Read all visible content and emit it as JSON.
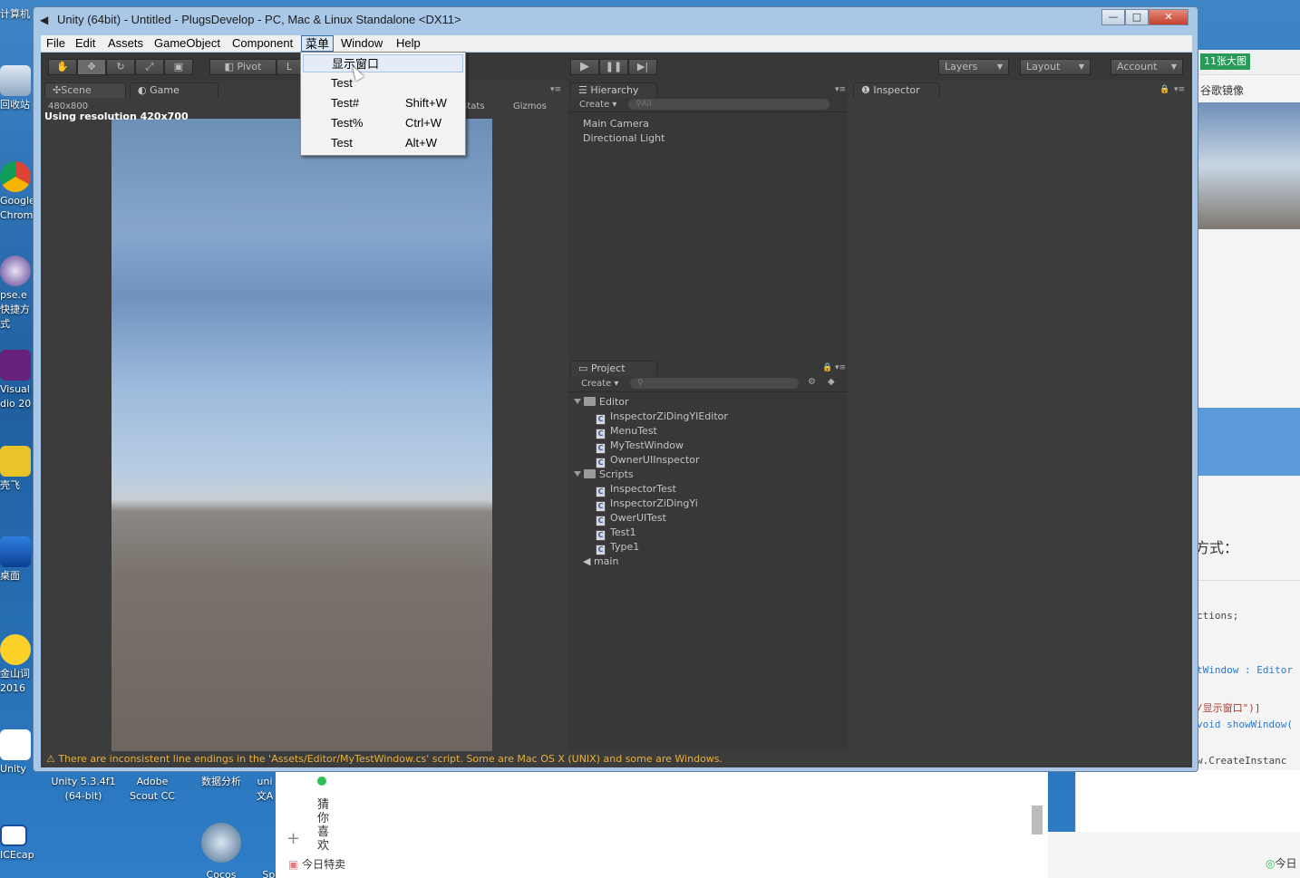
{
  "desktop": {
    "left_icons": [
      {
        "label": "计算机",
        "icon": "computer-icon"
      },
      {
        "label": "回收站",
        "icon": "recycle-bin-icon"
      },
      {
        "label": "Google Chrome",
        "line1": "Google",
        "line2": "Chrome",
        "icon": "chrome-icon"
      },
      {
        "label": "Eclipse",
        "line1": "pse.e",
        "line2": "快捷方式",
        "icon": "eclipse-icon"
      },
      {
        "label": "Visual Studio 2015",
        "line1": "Visual",
        "line2": "dio 20",
        "icon": "visual-studio-icon"
      },
      {
        "label": "飞壳",
        "line1": "壳飞",
        "icon": "app-m-icon"
      },
      {
        "label": "桌面",
        "line1": "桌面",
        "icon": "desktop-shortcut-icon"
      },
      {
        "label": "金山词霸 2016",
        "line1": "金山词",
        "line2": "2016",
        "icon": "dictionary-icon"
      },
      {
        "label": "Unity",
        "icon": "unity-icon"
      },
      {
        "label": "ICEcap",
        "icon": "icecap-icon"
      }
    ],
    "bottom_icons": [
      {
        "line1": "Unity 5.3.4f1",
        "line2": "(64-bit)"
      },
      {
        "line1": "Adobe",
        "line2": "Scout CC"
      },
      {
        "line1": "数据分析",
        "line2": ""
      },
      {
        "line1": "uni",
        "line2": "文A"
      },
      {
        "line1": "Cocos",
        "line2": ""
      },
      {
        "line1": "Splashplus",
        "line2": ""
      }
    ]
  },
  "bg_window": {
    "badge": "11张大图",
    "link": "谷歌镜像",
    "heading": "方式：",
    "code_lines": [
      "ctions;",
      "tWindow : Editor",
      "/显示窗口\")]",
      "void showWindow(",
      "w.CreateInstanc",
      "}",
      "}"
    ]
  },
  "browser": {
    "side_text": "猜你喜欢",
    "plus": "+",
    "footer": "今日特卖",
    "right_footer": "今日"
  },
  "unity": {
    "title": "Unity (64bit) - Untitled - PlugsDevelop - PC, Mac & Linux Standalone <DX11>",
    "window_buttons": {
      "min": "—",
      "max": "□",
      "close": "✕"
    },
    "menu": [
      "File",
      "Edit",
      "Assets",
      "GameObject",
      "Component",
      "菜单",
      "Window",
      "Help"
    ],
    "active_menu": "菜单",
    "toolbar": {
      "pivot": "Pivot",
      "local": "L",
      "layers": "Layers",
      "layout": "Layout",
      "account": "Account"
    },
    "scene_tab": "Scene",
    "game_tab": "Game",
    "resolution_dropdown": "480x800",
    "resolution_message": "Using resolution 420x700",
    "stats": "Stats",
    "gizmos": "Gizmos",
    "hierarchy": {
      "tab": "Hierarchy",
      "create": "Create",
      "search_placeholder": "All",
      "items": [
        "Main Camera",
        "Directional Light"
      ]
    },
    "inspector": {
      "tab": "Inspector"
    },
    "project": {
      "tab": "Project",
      "create": "Create",
      "tree": [
        {
          "type": "folder",
          "name": "Editor",
          "depth": 0
        },
        {
          "type": "script",
          "name": "InspectorZiDingYIEditor",
          "depth": 1
        },
        {
          "type": "script",
          "name": "MenuTest",
          "depth": 1
        },
        {
          "type": "script",
          "name": "MyTestWindow",
          "depth": 1
        },
        {
          "type": "script",
          "name": "OwnerUIInspector",
          "depth": 1
        },
        {
          "type": "folder",
          "name": "Scripts",
          "depth": 0
        },
        {
          "type": "script",
          "name": "InspectorTest",
          "depth": 1
        },
        {
          "type": "script",
          "name": "InspectorZiDingYi",
          "depth": 1
        },
        {
          "type": "script",
          "name": "OwerUITest",
          "depth": 1
        },
        {
          "type": "script",
          "name": "Test1",
          "depth": 1
        },
        {
          "type": "script",
          "name": "Type1",
          "depth": 1
        },
        {
          "type": "scene",
          "name": "main",
          "depth": 0
        }
      ]
    },
    "status_message": "There are inconsistent line endings in the 'Assets/Editor/MyTestWindow.cs' script. Some are Mac OS X (UNIX) and some are Windows.",
    "dropdown": [
      {
        "label": "显示窗口",
        "shortcut": ""
      },
      {
        "label": "Test",
        "shortcut": ""
      },
      {
        "label": "Test#",
        "shortcut": "Shift+W"
      },
      {
        "label": "Test%",
        "shortcut": "Ctrl+W"
      },
      {
        "label": "Test",
        "shortcut": "Alt+W"
      }
    ]
  },
  "colors": {
    "accent": "#3d6ea3",
    "warning": "#e7b23a",
    "editor_bg": "#383838"
  }
}
